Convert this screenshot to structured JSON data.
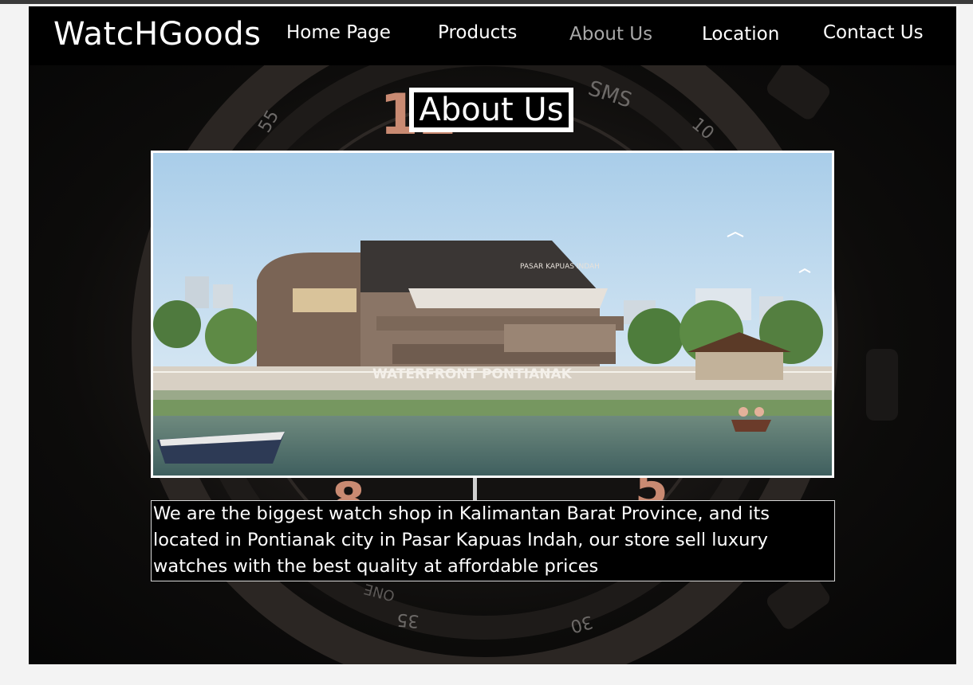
{
  "brand": "WatcHGoods",
  "nav": {
    "items": [
      {
        "label": "Home Page"
      },
      {
        "label": "Products"
      },
      {
        "label": "About Us",
        "active": true
      },
      {
        "label": "Location"
      },
      {
        "label": "Contact Us"
      }
    ]
  },
  "main": {
    "title": "About Us",
    "image": {
      "sign_text": "WATERFRONT PONTIANAK",
      "roof_text": "PASAR KAPUAS INDAH"
    },
    "description": "We are the biggest watch shop in Kalimantan Barat Province, and its located in Pontianak city in Pasar Kapuas Indah, our store sell luxury watches with the best quality at affordable prices"
  },
  "background": {
    "watch_markings": [
      "SMS",
      "10",
      "55",
      "35",
      "30",
      "ONE"
    ]
  },
  "colors": {
    "nav_bg": "#000000",
    "nav_text": "#ffffff",
    "nav_active": "#a8a8a8",
    "accent_rose_gold": "#d9a08a"
  }
}
